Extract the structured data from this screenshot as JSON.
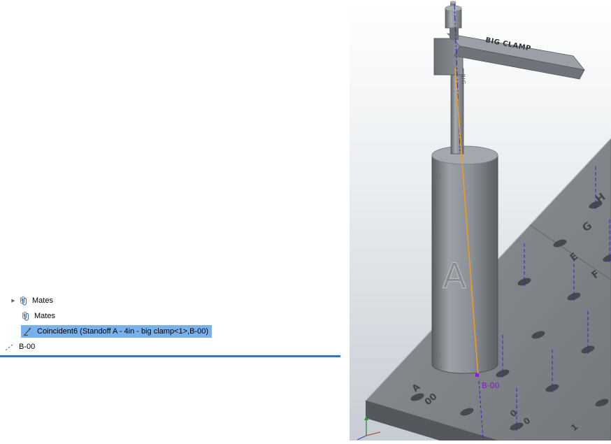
{
  "feature_tree": {
    "rows": [
      {
        "label": "Mates",
        "icon": "mates-icon",
        "expandable": true
      },
      {
        "label": "Mates",
        "icon": "mates-icon"
      },
      {
        "label": "Coincident6 (Standoff A - 4in - big clamp<1>,B-00)",
        "icon": "coincident-mate-icon",
        "selected": true
      },
      {
        "label": "B-00",
        "icon": "sketch-axis-icon"
      }
    ]
  },
  "viewport": {
    "engravings": {
      "clamp": "BIG CLAMP",
      "rod": "BIG",
      "standoff": "A"
    },
    "plate_labels": {
      "h": "H",
      "g": "G",
      "e": "E",
      "f": "F",
      "row_a": "A",
      "col_00": "00",
      "col_0a": "0",
      "col_0b": "0",
      "col_1": "1"
    },
    "annotations": {
      "b00": "B-00"
    },
    "colors": {
      "selection_highlight": "#7ab1ec",
      "rollback_bar": "#3477c2",
      "mate_centerline_orange": "#f2991f",
      "b00_purple": "#7b1fc8",
      "hole_axis_blue": "#2a2ac8",
      "plate_gray": "#82878c",
      "cylinder_gray": "#8a9095"
    }
  }
}
